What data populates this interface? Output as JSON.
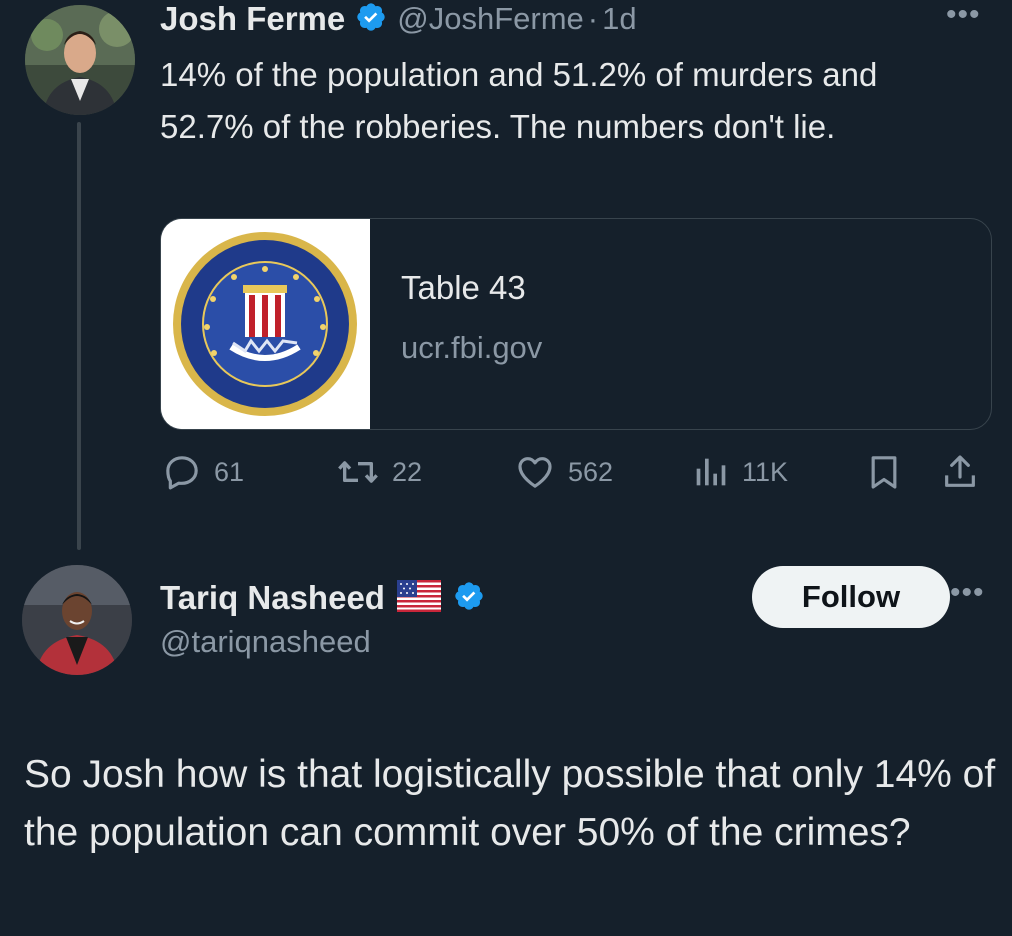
{
  "tweet1": {
    "author_name": "Josh Ferme",
    "handle": "@JoshFerme",
    "separator": "·",
    "time": "1d",
    "text": "14% of the population and 51.2% of murders and 52.7% of the robberies. The numbers don't lie.",
    "card": {
      "title": "Table 43",
      "domain": "ucr.fbi.gov",
      "thumbnail_icon": "fbi-seal-icon"
    },
    "stats": {
      "replies": "61",
      "retweets": "22",
      "likes": "562",
      "views": "11K"
    }
  },
  "tweet2": {
    "author_name": "Tariq Nasheed",
    "flag_icon": "us-flag-icon",
    "handle": "@tariqnasheed",
    "follow_label": "Follow",
    "text": "So Josh how is that logistically possible that only 14% of the population can commit over 50% of the crimes?"
  },
  "colors": {
    "background": "#15202b",
    "text_primary": "#e7e9ea",
    "text_secondary": "#8b98a5",
    "verified_badge": "#1d9bf0",
    "follow_button_bg": "#eff3f4"
  }
}
